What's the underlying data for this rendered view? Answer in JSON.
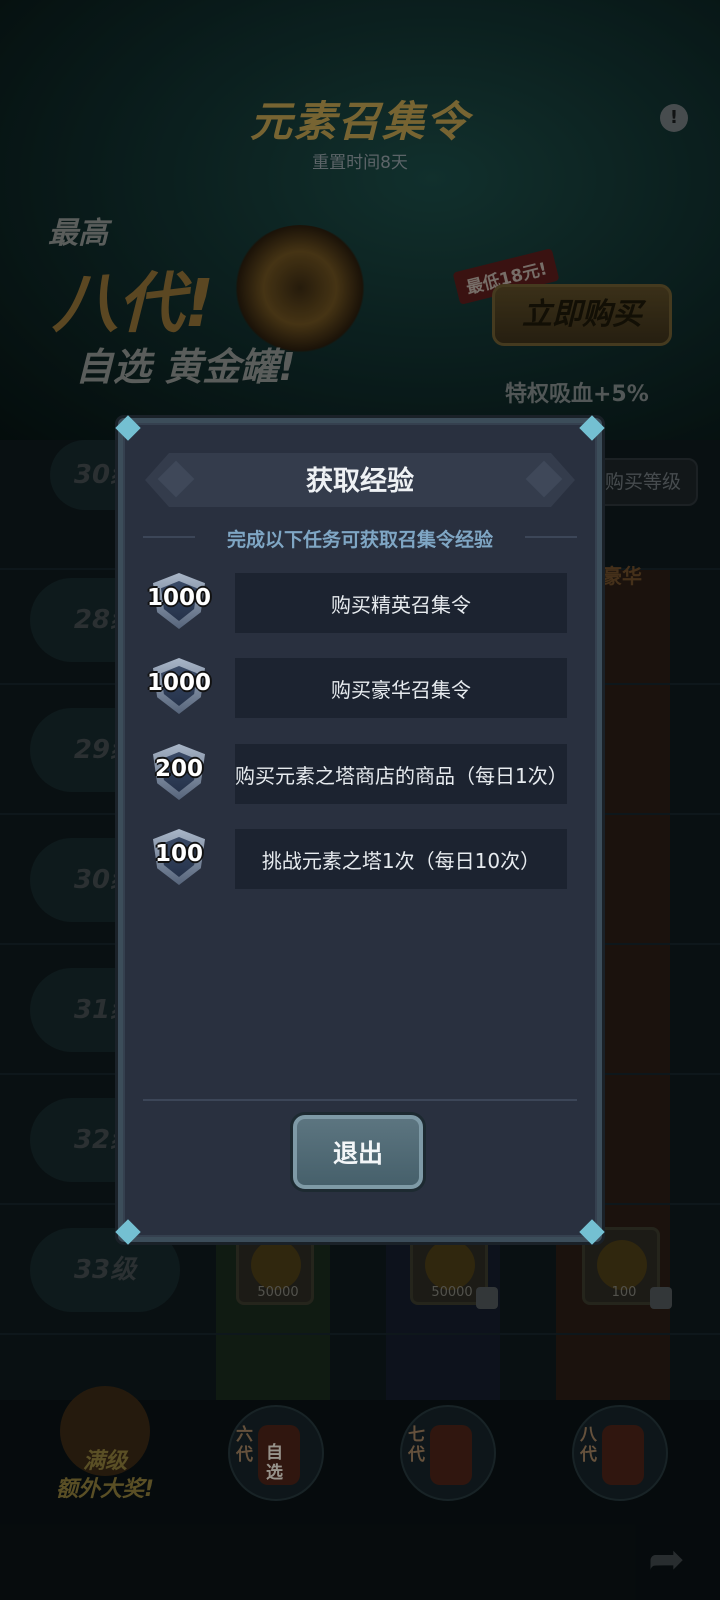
{
  "banner": {
    "title": "元素召集令",
    "reset_text": "重置时间8天",
    "info_glyph": "!",
    "promo_line1": "最高",
    "promo_line2": "八代!",
    "promo_line3": "自选 黄金罐!",
    "price_tag": "最低18元!",
    "buy_now_label": "立即购买",
    "privilege_text": "特权吸血+5%"
  },
  "grid": {
    "buy_level_label": "购买等级",
    "premium_label": "豪华",
    "levels": [
      "30级",
      "28级",
      "29级",
      "30级",
      "31级",
      "32级",
      "33级"
    ],
    "coin_counts": [
      "50000",
      "50000",
      "100"
    ]
  },
  "bottom": {
    "max_reward_label": "满级\n额外大奖!",
    "jars": [
      {
        "tag": "六代",
        "sub": "自选"
      },
      {
        "tag": "七代",
        "sub": ""
      },
      {
        "tag": "八代",
        "sub": ""
      }
    ]
  },
  "modal": {
    "title": "获取经验",
    "subtitle": "完成以下任务可获取召集令经验",
    "tasks": [
      {
        "exp": "1000",
        "label": "购买精英召集令"
      },
      {
        "exp": "1000",
        "label": "购买豪华召集令"
      },
      {
        "exp": "200",
        "label": "购买元素之塔商店的商品（每日1次）"
      },
      {
        "exp": "100",
        "label": "挑战元素之塔1次（每日10次）"
      }
    ],
    "exit_label": "退出"
  },
  "colors": {
    "modal_bg": "#29303f",
    "task_bg": "#1c2330",
    "subtitle": "#7fa6c4",
    "button": "#4f6a75"
  }
}
